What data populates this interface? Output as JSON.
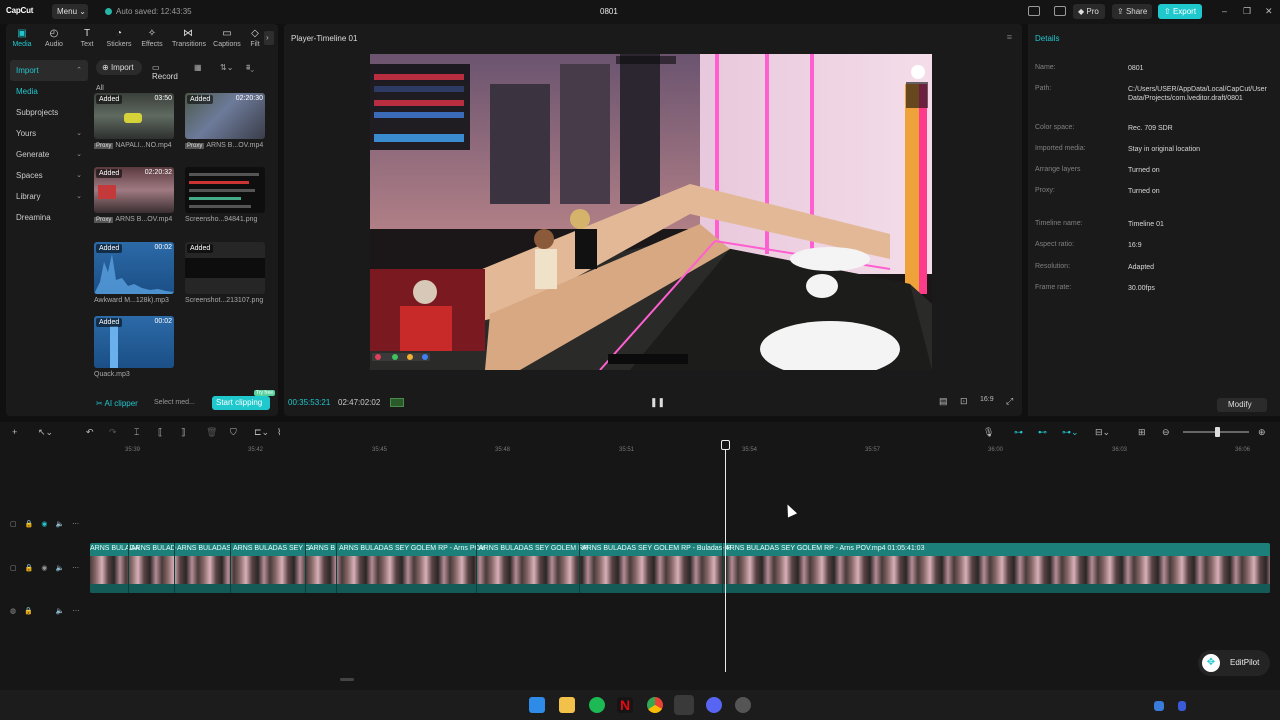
{
  "app": {
    "logo": "CapCut",
    "menu_label": "Menu",
    "autosave": "Auto saved: 12:43:35",
    "project_title": "0801",
    "pro_label": "Pro",
    "share_label": "Share",
    "export_label": "Export",
    "accent_color": "#1fc8cc"
  },
  "toolbar_tabs": [
    "Media",
    "Audio",
    "Text",
    "Stickers",
    "Effects",
    "Transitions",
    "Captions",
    "Filt"
  ],
  "nav": {
    "import": "Import",
    "media": "Media",
    "subprojects": "Subprojects",
    "yours": "Yours",
    "generate": "Generate",
    "spaces": "Spaces",
    "library": "Library",
    "dreamina": "Dreamina"
  },
  "media_toolbar": {
    "import_label": "Import",
    "record_label": "Record",
    "filter_all": "All"
  },
  "media_items": [
    {
      "tag": "Added",
      "duration": "03:50",
      "proxy": "Proxy",
      "name": "NAPALI...NO.mp4"
    },
    {
      "tag": "Added",
      "duration": "02:20:30",
      "proxy": "Proxy",
      "name": "ARNS B...OV.mp4"
    },
    {
      "tag": "Added",
      "duration": "02:20:32",
      "proxy": "Proxy",
      "name": "ARNS B...OV.mp4"
    },
    {
      "tag": "",
      "duration": "",
      "proxy": "",
      "name": "Screensho...94841.png"
    },
    {
      "tag": "Added",
      "duration": "00:02",
      "proxy": "",
      "name": "Awkward M...128k).mp3"
    },
    {
      "tag": "Added",
      "duration": "",
      "proxy": "",
      "name": "Screenshot...213107.png"
    },
    {
      "tag": "Added",
      "duration": "00:02",
      "proxy": "",
      "name": "Quack.mp3"
    }
  ],
  "clipper": {
    "ai_clipper": "AI clipper",
    "select_media": "Select med...",
    "start_clipping": "Start clipping",
    "free_tag": "Try free"
  },
  "player": {
    "title": "Player-Timeline 01",
    "current_time": "00:35:53:21",
    "total_time": "02:47:02:02"
  },
  "details": {
    "header": "Details",
    "rows": [
      {
        "key": "Name:",
        "value": "0801"
      },
      {
        "key": "Path:",
        "value": "C:/Users/USER/AppData/Local/CapCut/User Data/Projects/com.lveditor.draft/0801"
      },
      {
        "key": "Color space:",
        "value": "Rec. 709 SDR"
      },
      {
        "key": "Imported media:",
        "value": "Stay in original location"
      },
      {
        "key": "Arrange layers",
        "value": "Turned on"
      },
      {
        "key": "Proxy:",
        "value": "Turned on"
      },
      {
        "key": "Timeline name:",
        "value": "Timeline 01"
      },
      {
        "key": "Aspect ratio:",
        "value": "16:9"
      },
      {
        "key": "Resolution:",
        "value": "Adapted"
      },
      {
        "key": "Frame rate:",
        "value": "30.00fps"
      }
    ],
    "modify_label": "Modify"
  },
  "timeline": {
    "ruler_ticks": [
      "35:39",
      "35:42",
      "35:45",
      "35:48",
      "35:51",
      "35:54",
      "35:57",
      "36:00",
      "36:03",
      "36:06"
    ],
    "clips": [
      "ARNS BULADA",
      "ARNS BULAD",
      "ARNS BULADAS",
      "ARNS BULADAS SEY G",
      "ARNS B",
      "ARNS BULADAS SEY GOLEM RP - Arns POV",
      "ARNS BULADAS SEY GOLEM RP",
      "ARNS BULADAS SEY GOLEM RP - Buladas- P",
      "ARNS BULADAS SEY GOLEM RP - Arns POV.mp4   01:05:41:03"
    ]
  },
  "editpilot_label": "EditPilot"
}
